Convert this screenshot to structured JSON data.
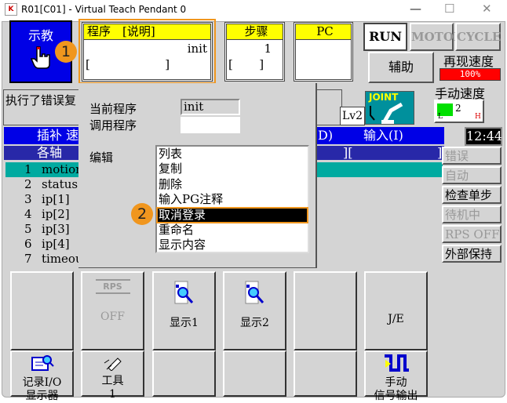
{
  "window": {
    "title": "R01[C01] - Virtual Teach Pendant 0",
    "minimize": "—",
    "maximize": "☐",
    "close": "✕",
    "app_icon": "K"
  },
  "mode_button": {
    "label": "示教",
    "icon": "hand-pointer-icon"
  },
  "badges": {
    "one": "1",
    "two": "2"
  },
  "program_box": {
    "header": "程序　[说明]",
    "value": "init",
    "comment": "[                    ]"
  },
  "step_box": {
    "header": "步骤",
    "value": "1",
    "comment": "[       ]"
  },
  "pc_box": {
    "header": "PC",
    "value": ""
  },
  "status_buttons": {
    "run": "RUN",
    "motor": "MOTOR",
    "cycle": "CYCLE"
  },
  "aux_button": "辅助",
  "replay_speed": {
    "label": "再现速度",
    "value": "100%",
    "color": "#ff0000"
  },
  "manual_speed": {
    "label": "手动速度",
    "level": "2",
    "low": "L",
    "high": "H"
  },
  "message": "执行了错误复",
  "level": "Lv2",
  "joint_icon": {
    "label": "JOINT",
    "color": "#00909c"
  },
  "clock": "12:44",
  "blue_row": {
    "left": "插补 速",
    "mid": "D)",
    "right": "输入(I)"
  },
  "axis_row": {
    "left": "各轴",
    "mid": "][",
    "right": "]"
  },
  "list": [
    {
      "num": "1",
      "name": "motion"
    },
    {
      "num": "2",
      "name": "status"
    },
    {
      "num": "3",
      "name": "ip[1]"
    },
    {
      "num": "4",
      "name": "ip[2]"
    },
    {
      "num": "5",
      "name": "ip[3]"
    },
    {
      "num": "6",
      "name": "ip[4]"
    },
    {
      "num": "7",
      "name": "timeou"
    }
  ],
  "side_buttons": [
    "错误",
    "自动",
    "检查单步",
    "待机中",
    "RPS OFF",
    "外部保持"
  ],
  "popup": {
    "current_label": "当前程序",
    "current_value": "init",
    "call_label": "调用程序",
    "call_value": "",
    "edit_label": "编辑",
    "edit_items": [
      "列表",
      "复制",
      "删除",
      "输入PG注释",
      "取消登录",
      "重命名",
      "显示内容"
    ],
    "selected_index": 4
  },
  "function_keys": {
    "rps": "RPS",
    "rps_off": "OFF",
    "display1": "显示1",
    "display2": "显示2",
    "je": "J/E",
    "io_monitor_1": "记录I/O",
    "io_monitor_2": "显示器",
    "tool_1": "工具",
    "tool_2": "1",
    "manual_out_1": "手动",
    "manual_out_2": "信号输出"
  }
}
